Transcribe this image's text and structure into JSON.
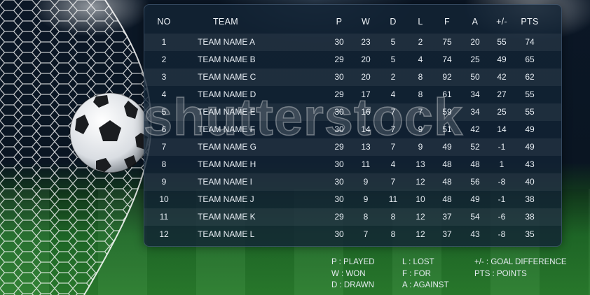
{
  "table": {
    "headers": {
      "no": "NO",
      "team": "TEAM",
      "p": "P",
      "w": "W",
      "d": "D",
      "l": "L",
      "f": "F",
      "a": "A",
      "gd": "+/-",
      "pts": "PTS"
    },
    "rows": [
      {
        "no": "1",
        "team": "TEAM NAME  A",
        "p": "30",
        "w": "23",
        "d": "5",
        "l": "2",
        "f": "75",
        "a": "20",
        "gd": "55",
        "pts": "74"
      },
      {
        "no": "2",
        "team": "TEAM NAME  B",
        "p": "29",
        "w": "20",
        "d": "5",
        "l": "4",
        "f": "74",
        "a": "25",
        "gd": "49",
        "pts": "65"
      },
      {
        "no": "3",
        "team": "TEAM NAME  C",
        "p": "30",
        "w": "20",
        "d": "2",
        "l": "8",
        "f": "92",
        "a": "50",
        "gd": "42",
        "pts": "62"
      },
      {
        "no": "4",
        "team": "TEAM NAME  D",
        "p": "29",
        "w": "17",
        "d": "4",
        "l": "8",
        "f": "61",
        "a": "34",
        "gd": "27",
        "pts": "55"
      },
      {
        "no": "5",
        "team": "TEAM NAME  E",
        "p": "30",
        "w": "16",
        "d": "7",
        "l": "7",
        "f": "59",
        "a": "34",
        "gd": "25",
        "pts": "55"
      },
      {
        "no": "6",
        "team": "TEAM NAME  F",
        "p": "30",
        "w": "14",
        "d": "7",
        "l": "9",
        "f": "51",
        "a": "42",
        "gd": "14",
        "pts": "49"
      },
      {
        "no": "7",
        "team": "TEAM NAME  G",
        "p": "29",
        "w": "13",
        "d": "7",
        "l": "9",
        "f": "49",
        "a": "52",
        "gd": "-1",
        "pts": "49"
      },
      {
        "no": "8",
        "team": "TEAM NAME  H",
        "p": "30",
        "w": "11",
        "d": "4",
        "l": "13",
        "f": "48",
        "a": "48",
        "gd": "1",
        "pts": "43"
      },
      {
        "no": "9",
        "team": "TEAM NAME  I",
        "p": "30",
        "w": "9",
        "d": "7",
        "l": "12",
        "f": "48",
        "a": "56",
        "gd": "-8",
        "pts": "40"
      },
      {
        "no": "10",
        "team": "TEAM NAME  J",
        "p": "30",
        "w": "9",
        "d": "11",
        "l": "10",
        "f": "48",
        "a": "49",
        "gd": "-1",
        "pts": "38"
      },
      {
        "no": "11",
        "team": "TEAM NAME  K",
        "p": "29",
        "w": "8",
        "d": "8",
        "l": "12",
        "f": "37",
        "a": "54",
        "gd": "-6",
        "pts": "38"
      },
      {
        "no": "12",
        "team": "TEAM NAME  L",
        "p": "30",
        "w": "7",
        "d": "8",
        "l": "12",
        "f": "37",
        "a": "43",
        "gd": "-8",
        "pts": "35"
      }
    ]
  },
  "legend": {
    "col1": [
      "P : PLAYED",
      "W : WON",
      "D : DRAWN"
    ],
    "col2": [
      "L : LOST",
      "F : FOR",
      "A : AGAINST"
    ],
    "col3": [
      "+/- : GOAL DIFFERENCE",
      "PTS : POINTS"
    ]
  },
  "watermark": "shutterstock",
  "colors": {
    "panel": "#122334",
    "pitch": "#2a7d2d",
    "sky": "#0b1726",
    "text": "#e7edf3"
  },
  "icons": [
    "soccer-ball-icon",
    "goal-net-icon"
  ]
}
